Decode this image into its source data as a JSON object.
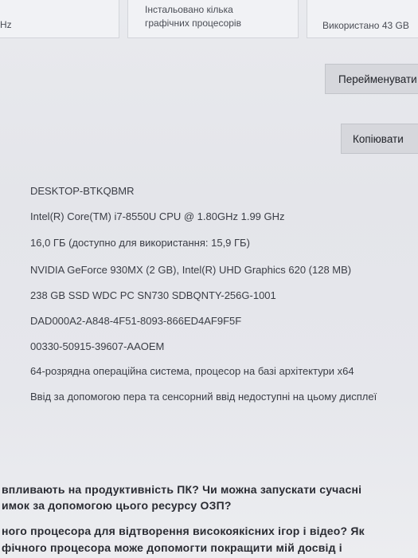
{
  "top_cards": {
    "left_fragment": "Hz",
    "middle_line1": "Інстальовано кілька",
    "middle_line2": "графічних процесорів",
    "right_text": "Використано 43 GB"
  },
  "buttons": {
    "rename_label": "Перейменувати",
    "copy_label": "Копіювати"
  },
  "specs": {
    "device_name": "DESKTOP-BTKQBMR",
    "processor": "Intel(R) Core(TM) i7-8550U CPU @ 1.80GHz   1.99 GHz",
    "ram": "16,0 ГБ (доступно для використання: 15,9 ГБ)",
    "graphics": "NVIDIA GeForce 930MX (2 GB), Intel(R) UHD Graphics 620 (128 MB)",
    "storage": "238 GB SSD WDC PC SN730 SDBQNTY-256G-1001",
    "device_id": "DAD000A2-A848-4F51-8093-866ED4AF9F5F",
    "product_id": "00330-50915-39607-AAOEM",
    "system_type": "64-розрядна операційна система, процесор на базі архітектури x64",
    "pen_touch": "Ввід за допомогою пера та сенсорний ввід недоступні на цьому дисплеї"
  },
  "questions": {
    "line1": "впливають на продуктивність ПК? Чи можна запускати сучасні",
    "line2": "имок за допомогою цього ресурсу ОЗП?",
    "line3": "ного процесора для відтворення високоякісних ігор і відео? Як",
    "line4": "фічного процесора може допомогти покращити мій досвід і"
  }
}
